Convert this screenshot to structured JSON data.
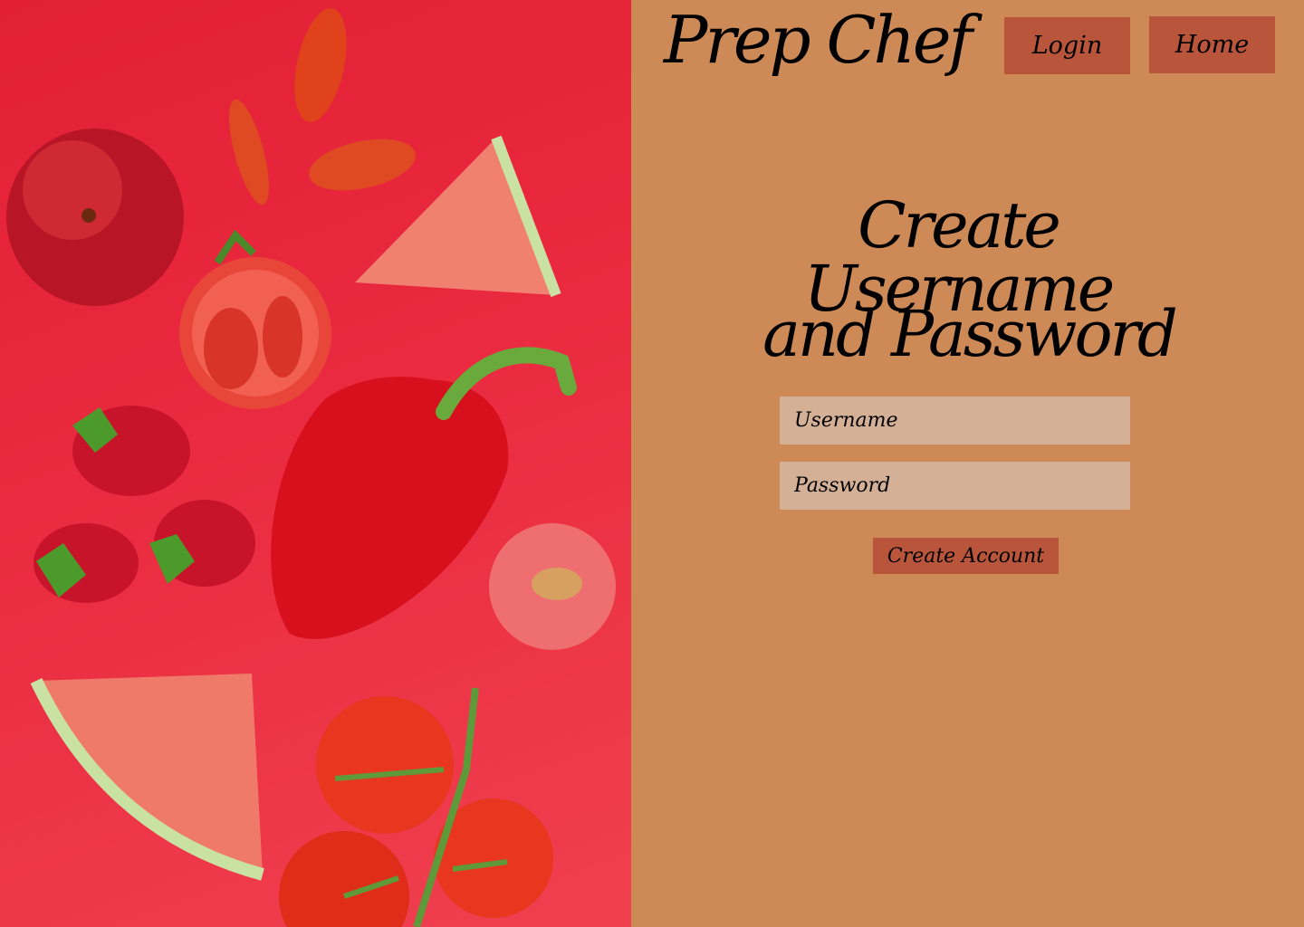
{
  "brand": {
    "name": "Prep Chef"
  },
  "nav": {
    "login_label": "Login",
    "home_label": "Home"
  },
  "form": {
    "heading_line1": "Create Username",
    "heading_line2": "and Password",
    "username_placeholder": "Username",
    "password_placeholder": "Password",
    "submit_label": "Create Account"
  },
  "colors": {
    "panel_background": "#cd8a57",
    "button": "#b9553a",
    "input": "#d4b096",
    "photo_background": "#e8283d"
  },
  "photo": {
    "subject": "red fruits and vegetables on red background"
  }
}
